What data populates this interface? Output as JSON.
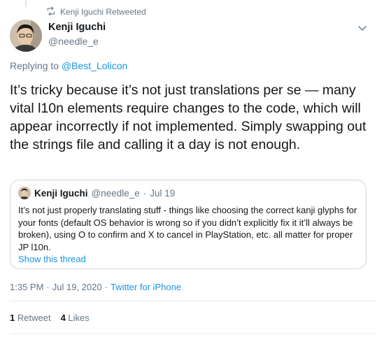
{
  "retweet": {
    "icon": "retweet-icon",
    "label": "Kenji Iguchi Retweeted"
  },
  "author": {
    "display_name": "Kenji Iguchi",
    "handle": "@needle_e"
  },
  "reply": {
    "prefix": "Replying to",
    "target": "@Best_Lolicon"
  },
  "tweet_text": "It’s tricky because it’s not just translations per se — many vital l10n elements require changes to the code, which will appear incorrectly if not implemented. Simply swapping out the strings file and calling it a day is not enough.",
  "quote": {
    "display_name": "Kenji Iguchi",
    "handle": "@needle_e",
    "separator": "·",
    "date": "Jul 19",
    "text": "It’s not just properly translating stuff - things like choosing the correct kanji glyphs for your fonts (default OS behavior is wrong so if you didn’t explicitly fix it it’ll always be broken), using O to confirm and X to cancel in PlayStation, etc. all matter for proper JP l10n.",
    "show_thread": "Show this thread"
  },
  "meta": {
    "time": "1:35 PM",
    "separator1": "·",
    "date": "Jul 19, 2020",
    "separator2": "·",
    "source": "Twitter for iPhone"
  },
  "stats": {
    "retweet_count": "1",
    "retweet_label": "Retweet",
    "like_count": "4",
    "like_label": "Likes"
  },
  "colors": {
    "link": "#1b95e0",
    "secondary_text": "#657786",
    "border": "#ccd6dd"
  }
}
